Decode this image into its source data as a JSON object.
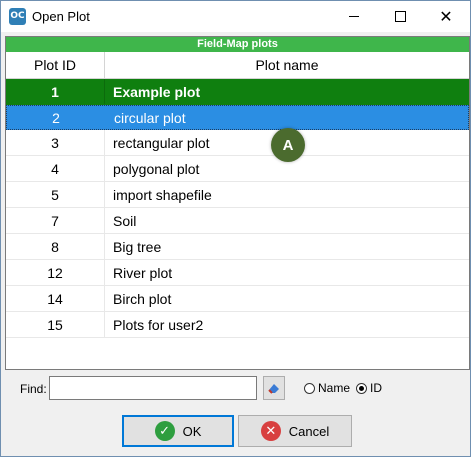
{
  "window": {
    "title": "Open Plot",
    "icon_text": "OC"
  },
  "controls": {
    "minimize": "minimize-icon",
    "maximize": "maximize-icon",
    "close": "close-icon"
  },
  "table": {
    "title": "Field-Map plots",
    "columns": [
      "Plot ID",
      "Plot name"
    ],
    "rows": [
      {
        "id": "1",
        "name": "Example plot",
        "style": "bold"
      },
      {
        "id": "2",
        "name": "circular plot",
        "style": "selected"
      },
      {
        "id": "3",
        "name": "rectangular plot",
        "style": "normal"
      },
      {
        "id": "4",
        "name": "polygonal plot",
        "style": "normal"
      },
      {
        "id": "5",
        "name": "import shapefile",
        "style": "normal"
      },
      {
        "id": "7",
        "name": "Soil",
        "style": "normal"
      },
      {
        "id": "8",
        "name": "Big tree",
        "style": "normal"
      },
      {
        "id": "12",
        "name": "River plot",
        "style": "normal"
      },
      {
        "id": "14",
        "name": "Birch plot",
        "style": "normal"
      },
      {
        "id": "15",
        "name": "Plots for user2",
        "style": "normal"
      }
    ]
  },
  "annotation": {
    "label": "A"
  },
  "find": {
    "label": "Find:",
    "value": "",
    "options": [
      {
        "label": "Name",
        "checked": false
      },
      {
        "label": "ID",
        "checked": true
      }
    ]
  },
  "buttons": {
    "ok": "OK",
    "cancel": "Cancel"
  },
  "colors": {
    "header_green": "#3fb64b",
    "bold_row": "#0f7f0f",
    "selected_row": "#2b8ee3",
    "badge": "#4b6b2e"
  }
}
